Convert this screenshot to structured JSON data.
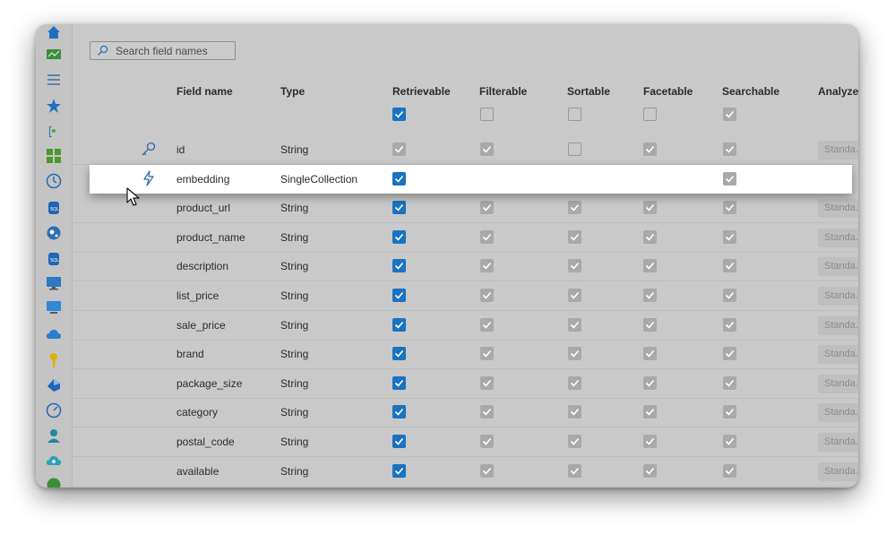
{
  "search": {
    "placeholder": "Search field names"
  },
  "sidebar": {
    "items": [
      {
        "icon": "home-icon"
      },
      {
        "icon": "monitor-chart-icon"
      },
      {
        "icon": "list-icon"
      },
      {
        "icon": "star-icon"
      },
      {
        "icon": "brackets-icon"
      },
      {
        "icon": "grid-icon"
      },
      {
        "icon": "clock-icon"
      },
      {
        "icon": "sql-database-icon"
      },
      {
        "icon": "cosmos-icon"
      },
      {
        "icon": "sql-server-icon"
      },
      {
        "icon": "virtual-machine-icon"
      },
      {
        "icon": "monitor-icon"
      },
      {
        "icon": "cloud-icon"
      },
      {
        "icon": "key-icon"
      },
      {
        "icon": "devops-icon"
      },
      {
        "icon": "dashboard-gauge-icon"
      },
      {
        "icon": "user-icon"
      },
      {
        "icon": "settings-cloud-icon"
      },
      {
        "icon": "globe-icon"
      }
    ]
  },
  "table": {
    "headers": {
      "field_name": "Field name",
      "type": "Type",
      "retrievable": "Retrievable",
      "filterable": "Filterable",
      "sortable": "Sortable",
      "facetable": "Facetable",
      "searchable": "Searchable",
      "analyzer": "Analyzer"
    },
    "header_checkboxes": {
      "retrievable": "on",
      "filterable": "off",
      "sortable": "off",
      "facetable": "off",
      "searchable": "dis"
    },
    "analyzer_value": "Standa...",
    "rows": [
      {
        "name": "id",
        "type": "String",
        "icon": "key-icon",
        "retrievable": "dis",
        "filterable": "dis",
        "sortable": "off",
        "facetable": "dis",
        "searchable": "dis",
        "analyzer": true
      },
      {
        "name": "embedding",
        "type": "SingleCollection",
        "icon": "lightning-icon",
        "highlight": true,
        "retrievable": "on",
        "filterable": "",
        "sortable": "",
        "facetable": "",
        "searchable": "dis",
        "analyzer": false
      },
      {
        "name": "product_url",
        "type": "String",
        "retrievable": "on",
        "filterable": "dis",
        "sortable": "dis",
        "facetable": "dis",
        "searchable": "dis",
        "analyzer": true
      },
      {
        "name": "product_name",
        "type": "String",
        "retrievable": "on",
        "filterable": "dis",
        "sortable": "dis",
        "facetable": "dis",
        "searchable": "dis",
        "analyzer": true
      },
      {
        "name": "description",
        "type": "String",
        "retrievable": "on",
        "filterable": "dis",
        "sortable": "dis",
        "facetable": "dis",
        "searchable": "dis",
        "analyzer": true
      },
      {
        "name": "list_price",
        "type": "String",
        "retrievable": "on",
        "filterable": "dis",
        "sortable": "dis",
        "facetable": "dis",
        "searchable": "dis",
        "analyzer": true
      },
      {
        "name": "sale_price",
        "type": "String",
        "retrievable": "on",
        "filterable": "dis",
        "sortable": "dis",
        "facetable": "dis",
        "searchable": "dis",
        "analyzer": true
      },
      {
        "name": "brand",
        "type": "String",
        "retrievable": "on",
        "filterable": "dis",
        "sortable": "dis",
        "facetable": "dis",
        "searchable": "dis",
        "analyzer": true
      },
      {
        "name": "package_size",
        "type": "String",
        "retrievable": "on",
        "filterable": "dis",
        "sortable": "dis",
        "facetable": "dis",
        "searchable": "dis",
        "analyzer": true
      },
      {
        "name": "category",
        "type": "String",
        "retrievable": "on",
        "filterable": "dis",
        "sortable": "dis",
        "facetable": "dis",
        "searchable": "dis",
        "analyzer": true
      },
      {
        "name": "postal_code",
        "type": "String",
        "retrievable": "on",
        "filterable": "dis",
        "sortable": "dis",
        "facetable": "dis",
        "searchable": "dis",
        "analyzer": true
      },
      {
        "name": "available",
        "type": "String",
        "retrievable": "on",
        "filterable": "dis",
        "sortable": "dis",
        "facetable": "dis",
        "searchable": "dis",
        "analyzer": true
      }
    ]
  },
  "colors": {
    "accent": "#1a73c0",
    "highlight_row": "#ffffff",
    "overlay": "#c9c9c9"
  }
}
